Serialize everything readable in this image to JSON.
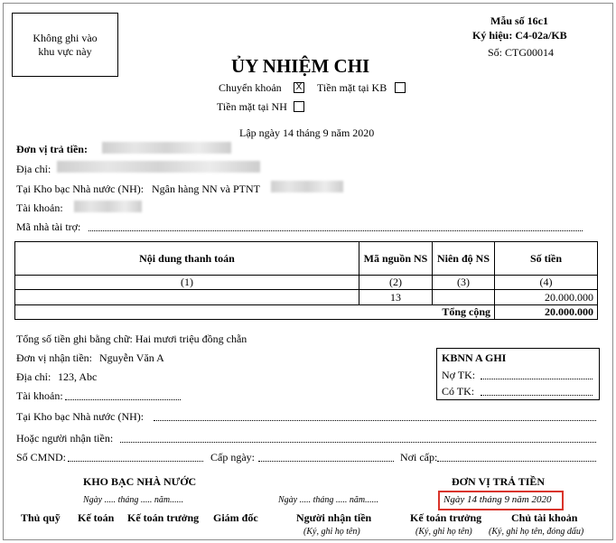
{
  "not_write_box": "Không ghi vào khu vực này",
  "form": {
    "template_no": "Mẫu số 16c1",
    "symbol": "Ký hiệu: C4-02a/KB",
    "number": "Số: CTG00014"
  },
  "title": "ỦY NHIỆM CHI",
  "payment_method": {
    "transfer_label": "Chuyển khoản",
    "transfer_mark": "X",
    "cash_kb_label": "Tiền mặt tại KB",
    "cash_nh_label": "Tiền mặt tại NH"
  },
  "date_line": "Lập ngày 14 tháng 9 năm 2020",
  "payer": {
    "unit_label": "Đơn vị trả tiền:",
    "address_label": "Địa chỉ:",
    "treasury_label": "Tại Kho bạc Nhà nước (NH):",
    "treasury_value": "Ngân hàng NN và PTNT",
    "account_label": "Tài khoản:",
    "sponsor_label": "Mã nhà tài trợ:"
  },
  "table": {
    "headers": [
      "Nội dung thanh toán",
      "Mã nguồn NS",
      "Niên độ NS",
      "Số tiền"
    ],
    "index_row": [
      "(1)",
      "(2)",
      "(3)",
      "(4)"
    ],
    "data_row": [
      "",
      "13",
      "",
      "20.000.000"
    ],
    "total_label": "Tổng cộng",
    "total_value": "20.000.000"
  },
  "amount_in_words": "Tổng số tiền ghi bằng chữ: Hai mươi triệu đồng chẵn",
  "payee": {
    "unit_label": "Đơn vị nhận tiền:",
    "unit_value": "Nguyễn Văn A",
    "address_label": "Địa chỉ:",
    "address_value": "123, Abc",
    "account_label": "Tài khoản:",
    "treasury_label": "Tại Kho bạc Nhà nước (NH):",
    "receiver_label": "Hoặc người nhận tiền:",
    "id_label": "Số CMND:",
    "issue_date_label": "Cấp ngày:",
    "issue_place_label": "Nơi cấp:"
  },
  "kbnn_box": {
    "title": "KBNN A GHI",
    "debit_label": "Nợ TK:",
    "credit_label": "Có TK:"
  },
  "signatures": {
    "treasury_title": "KHO BẠC NHÀ NƯỚC",
    "treasury_date": "Ngày ..... tháng ..... năm......",
    "receiver_date": "Ngày ..... tháng ..... năm......",
    "payer_title": "ĐƠN VỊ TRẢ TIỀN",
    "payer_date": "Ngày 14 tháng 9 năm 2020",
    "roles": [
      "Thủ quỹ",
      "Kế toán",
      "Kế toán trưởng",
      "Giám đốc",
      "Người nhận tiền",
      "Kế toán trưởng",
      "Chủ tài khoản"
    ],
    "receiver_note": "(Ký, ghi họ tên)",
    "accountant_note": "(Ký, ghi họ tên)",
    "owner_note": "(Ký, ghi họ tên, đóng dấu)"
  },
  "highlight_color": "#d9342b"
}
